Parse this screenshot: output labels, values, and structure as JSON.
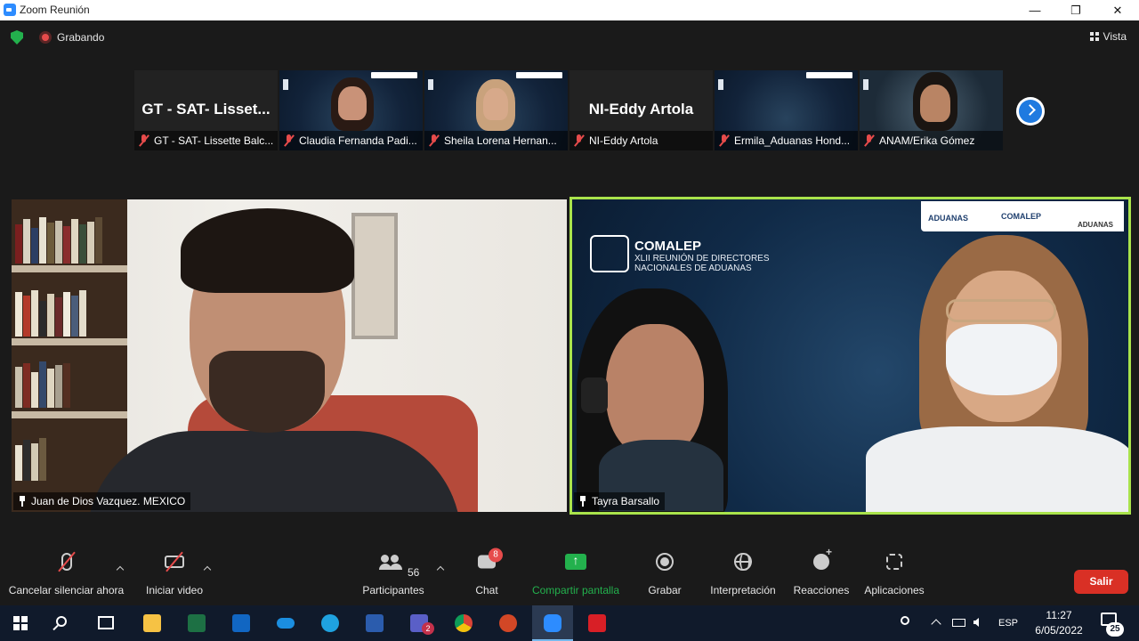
{
  "window": {
    "title": "Zoom Reunión",
    "controls": [
      "—",
      "❐",
      "✕"
    ]
  },
  "status": {
    "recording_label": "Grabando",
    "view_label": "Vista"
  },
  "thumbnails": [
    {
      "caption": "GT - SAT- Lissette Balc...",
      "display_name": "GT - SAT- Lisset...",
      "type": "name"
    },
    {
      "caption": "Claudia Fernanda Padi...",
      "type": "video"
    },
    {
      "caption": "Sheila Lorena Hernan...",
      "type": "video"
    },
    {
      "caption": "NI-Eddy Artola",
      "display_name": "NI-Eddy Artola",
      "type": "name"
    },
    {
      "caption": "Ermila_Aduanas Hond...",
      "type": "video"
    },
    {
      "caption": "ANAM/Erika Gómez",
      "type": "video"
    }
  ],
  "main_videos": [
    {
      "name": "Juan de Dios Vazquez. MEXICO"
    },
    {
      "name": "Tayra Barsallo",
      "banner_title": "COMALEP",
      "banner_line1": "XLII REUNIÓN DE DIRECTORES",
      "banner_line2": "NACIONALES DE ADUANAS",
      "header_logos": [
        "ADUANAS",
        "COMALEP",
        "ADUANAS"
      ]
    }
  ],
  "toolbar": {
    "mute_label": "Cancelar silenciar ahora",
    "video_label": "Iniciar video",
    "participants_label": "Participantes",
    "participants_count": "56",
    "chat_label": "Chat",
    "chat_badge": "8",
    "share_label": "Compartir pantalla",
    "record_label": "Grabar",
    "interpret_label": "Interpretación",
    "reactions_label": "Reacciones",
    "apps_label": "Aplicaciones",
    "leave_label": "Salir"
  },
  "taskbar": {
    "language": "ESP",
    "time": "11:27",
    "date": "6/05/2022",
    "notifications": "25",
    "apps": [
      "file-explorer",
      "excel",
      "outlook",
      "onedrive",
      "internet-explorer",
      "word",
      "teams",
      "chrome",
      "powerpoint",
      "zoom",
      "acrobat"
    ],
    "teams_badge": "2"
  },
  "colors": {
    "accent_green": "#23b14d",
    "active_speaker_border": "#a9e34b",
    "leave_red": "#d93025",
    "next_blue": "#1f7ae0"
  }
}
